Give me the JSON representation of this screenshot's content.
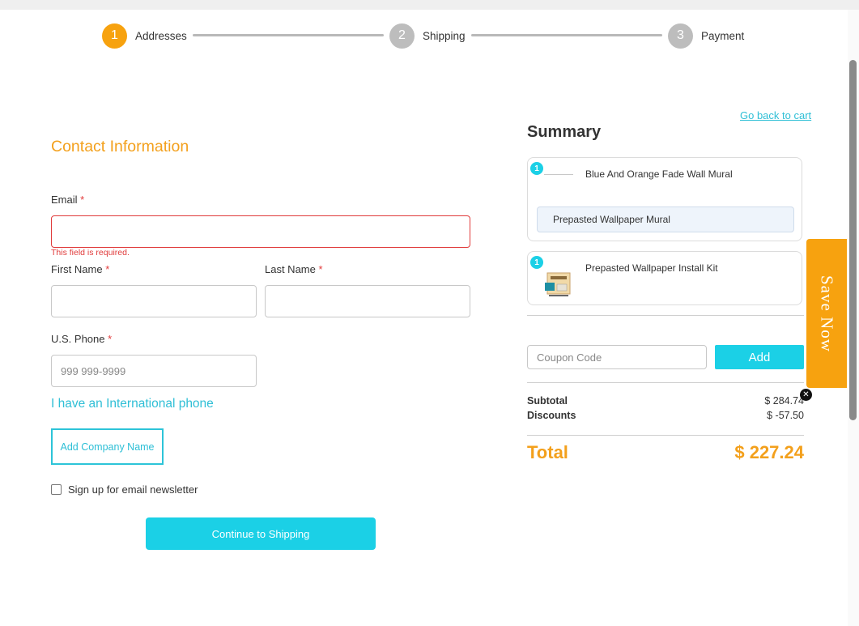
{
  "stepper": {
    "steps": [
      {
        "number": "1",
        "label": "Addresses",
        "state": "active"
      },
      {
        "number": "2",
        "label": "Shipping",
        "state": "inactive"
      },
      {
        "number": "3",
        "label": "Payment",
        "state": "inactive"
      }
    ]
  },
  "form": {
    "section_title": "Contact Information",
    "email_label": "Email",
    "required_mark": "*",
    "email_value": "",
    "email_error": "This field is required.",
    "first_name_label": "First Name",
    "first_name_value": "",
    "last_name_label": "Last Name",
    "last_name_value": "",
    "phone_label": "U.S. Phone",
    "phone_placeholder": "999 999-9999",
    "international_phone_link": "I have an International phone",
    "add_company_button": "Add Company Name",
    "newsletter_label": "Sign up for email newsletter",
    "newsletter_checked": false,
    "continue_button": "Continue to Shipping"
  },
  "summary": {
    "back_link": "Go back to cart",
    "title": "Summary",
    "items": [
      {
        "qty": "1",
        "name": "Blue And Orange Fade Wall Mural",
        "variant": "Prepasted Wallpaper Mural"
      },
      {
        "qty": "1",
        "name": "Prepasted Wallpaper Install Kit"
      }
    ],
    "coupon_placeholder": "Coupon Code",
    "add_button": "Add",
    "subtotal_label": "Subtotal",
    "subtotal_value": "$ 284.74",
    "discounts_label": "Discounts",
    "discounts_value": "$ -57.50",
    "total_label": "Total",
    "total_value": "$ 227.24"
  },
  "promo": {
    "save_now_label": "Save Now",
    "close_glyph": "✕"
  },
  "colors": {
    "accent_orange": "#f7a20f",
    "accent_cyan": "#1bd0e6",
    "error_red": "#e03b3b"
  }
}
